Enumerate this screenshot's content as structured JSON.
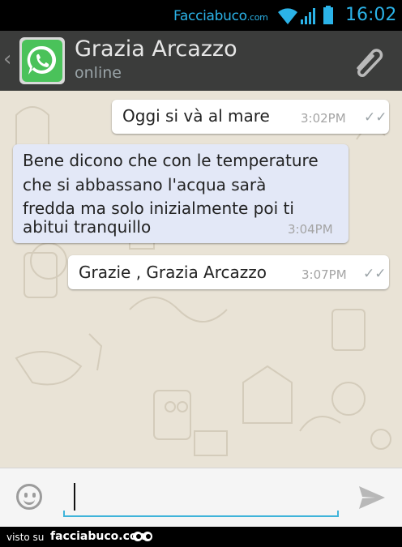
{
  "status_bar": {
    "watermark": "Facciabuco",
    "watermark_suffix": ".com",
    "time": "16:02",
    "icons": [
      "wifi-icon",
      "signal-icon",
      "battery-icon"
    ]
  },
  "header": {
    "back_glyph": "‹",
    "contact_name": "Grazia Arcazzo",
    "contact_status": "online",
    "accent": "#3b3c3b"
  },
  "messages": [
    {
      "direction": "outgoing",
      "text": "Oggi si và al mare",
      "time": "3:02PM",
      "ticks": "✓✓"
    },
    {
      "direction": "incoming",
      "lines": [
        "Bene dicono che con le temperature",
        "che si abbassano l'acqua sarà",
        "fredda ma solo inizialmente poi ti",
        "abitui tranquillo"
      ],
      "time": "3:04PM"
    },
    {
      "direction": "outgoing",
      "text": "Grazie , Grazia Arcazzo",
      "time": "3:07PM",
      "ticks": "✓✓"
    }
  ],
  "composer": {
    "placeholder": "",
    "value": "",
    "accent": "#3fb4da"
  },
  "footer": {
    "visto_su": "visto su",
    "site": "facciabuco.com"
  }
}
